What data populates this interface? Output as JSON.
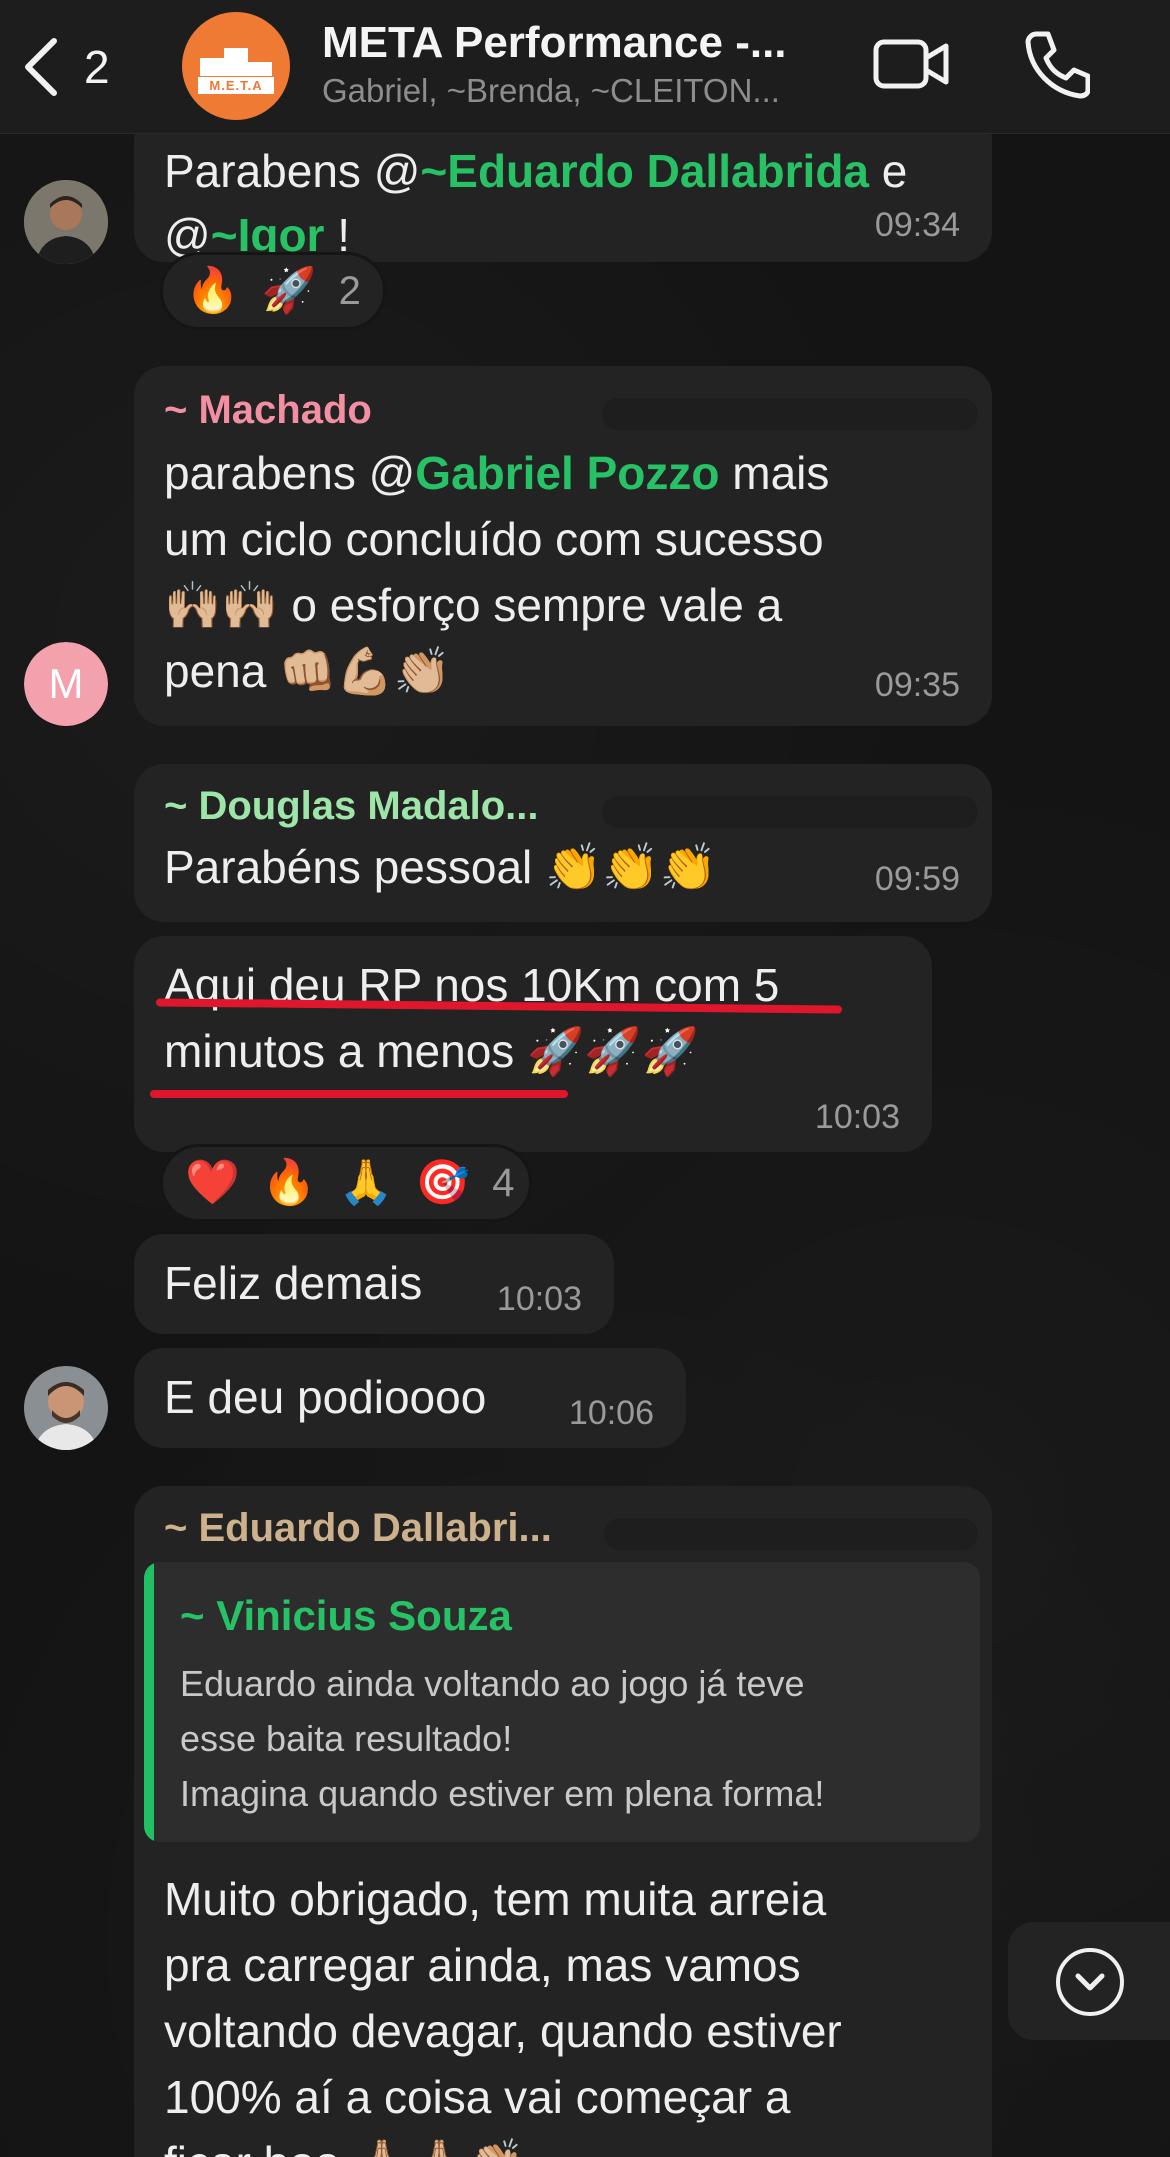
{
  "header": {
    "back_count": "2",
    "group_title": "META Performance -...",
    "group_subtitle": "Gabriel, ~Brenda, ~CLEITON...",
    "avatar_label": "M.E.T.A"
  },
  "messages": [
    {
      "line1_prefix": "Parabens @",
      "line1_mention": "~Eduardo Dallabrida",
      "line1_suffix": " e",
      "line2_prefix": "@",
      "line2_mention": "~Igor",
      "line2_suffix": " !",
      "time": "09:34",
      "reactions": {
        "emojis": [
          "🔥",
          "🚀"
        ],
        "count": "2"
      }
    },
    {
      "sender": "~ Machado",
      "sender_color": "#f38fa3",
      "line1_prefix": "parabens @",
      "line1_mention": "Gabriel Pozzo",
      "line1_suffix": " mais",
      "line2": "um ciclo concluído com sucesso",
      "line3": "🙌🏼🙌🏼 o esforço sempre vale a",
      "line4": "pena 👊🏼💪🏼👏🏼",
      "time": "09:35",
      "avatar_letter": "M",
      "avatar_color": "#f4a1ae"
    },
    {
      "sender": "~ Douglas Madalo...",
      "sender_color": "#9ee5a9",
      "text": "Parabéns pessoal 👏👏👏",
      "time": "09:59"
    },
    {
      "line1": "Aqui deu RP nos 10Km com 5",
      "line2": "minutos a menos 🚀🚀🚀",
      "time": "10:03",
      "reactions": {
        "emojis": [
          "❤️",
          "🔥",
          "🙏",
          "🎯"
        ],
        "count": "4"
      }
    },
    {
      "text": "Feliz demais",
      "time": "10:03"
    },
    {
      "text": "E deu podioooo",
      "time": "10:06"
    },
    {
      "sender": "~ Eduardo Dallabri...",
      "sender_color": "#cdb18c",
      "quote": {
        "sender": "~ Vinicius Souza",
        "line1": "Eduardo ainda voltando ao jogo já teve",
        "line2": "esse baita resultado!",
        "line3": "Imagina quando estiver em plena forma!"
      },
      "line1": "Muito obrigado, tem muita arreia",
      "line2": "pra carregar ainda, mas vamos",
      "line3": "voltando devagar, quando estiver",
      "line4": "100% aí a  coisa vai começar a",
      "line5": "ficar boa 🙏🏼🙏🏼👏🏼"
    }
  ]
}
